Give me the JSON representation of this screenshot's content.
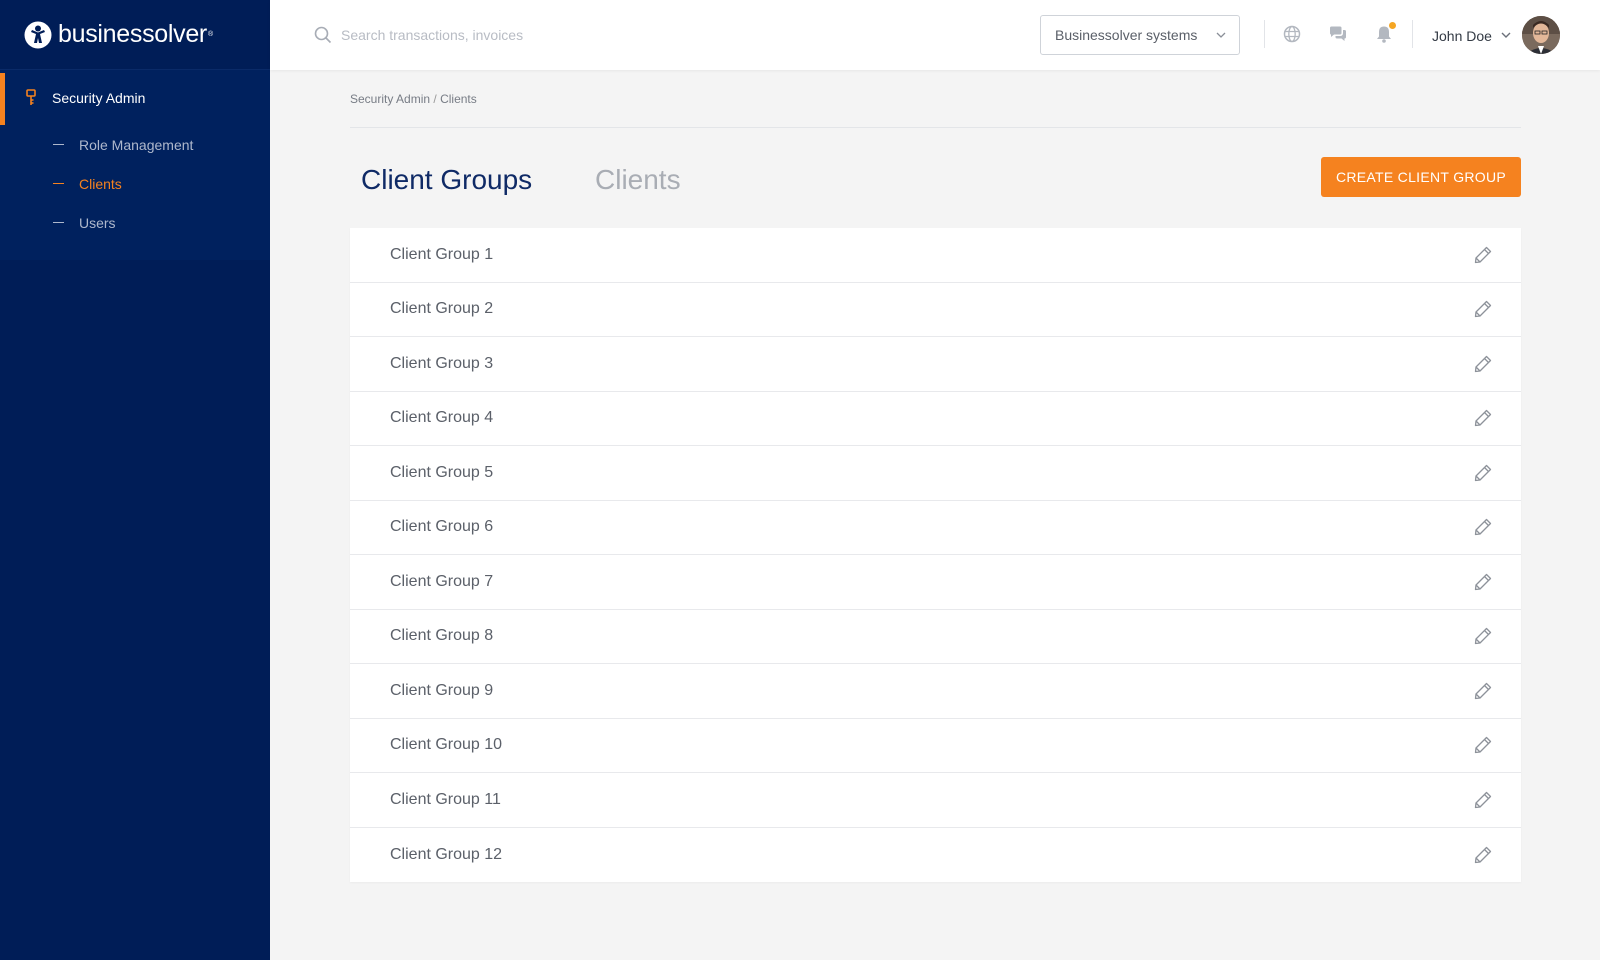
{
  "app": {
    "brand": "businessolver",
    "accent_color": "#f5821f",
    "sidebar_color": "#001d57"
  },
  "sidebar": {
    "section": {
      "label": "Security Admin",
      "icon": "key-icon"
    },
    "items": [
      {
        "label": "Role Management",
        "active": false
      },
      {
        "label": "Clients",
        "active": true
      },
      {
        "label": "Users",
        "active": false
      }
    ]
  },
  "header": {
    "search": {
      "placeholder": "Search transactions, invoices",
      "value": ""
    },
    "system_select": {
      "value": "Businessolver systems"
    },
    "icons": [
      "globe-icon",
      "chat-icon",
      "bell-icon"
    ],
    "user": {
      "name": "John Doe"
    }
  },
  "breadcrumb": {
    "parent": "Security Admin",
    "separator": "/",
    "current": "Clients"
  },
  "tabs": [
    {
      "label": "Client Groups",
      "active": true
    },
    {
      "label": "Clients",
      "active": false
    }
  ],
  "actions": {
    "create_label": "CREATE CLIENT GROUP"
  },
  "client_groups": [
    "Client Group 1",
    "Client Group 2",
    "Client Group 3",
    "Client Group 4",
    "Client Group 5",
    "Client Group 6",
    "Client Group 7",
    "Client Group 8",
    "Client Group 9",
    "Client Group 10",
    "Client Group 11",
    "Client Group 12"
  ]
}
